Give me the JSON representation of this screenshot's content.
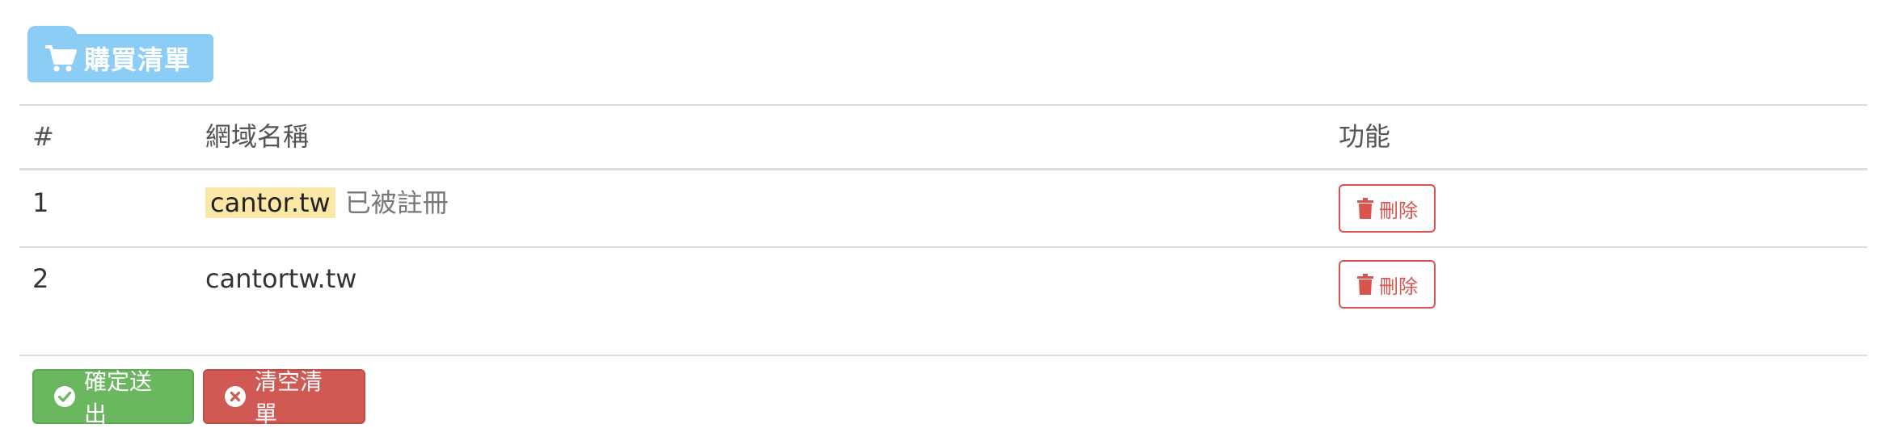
{
  "header": {
    "badge_label": "購買清單",
    "badge_icon": "shopping-cart-icon",
    "badge_color": "#8bcdf5"
  },
  "table": {
    "columns": [
      "#",
      "網域名稱",
      "功能"
    ],
    "rows": [
      {
        "num": "1",
        "domain": "cantor.tw",
        "status_note": "已被註冊",
        "action_label": "刪除"
      },
      {
        "num": "2",
        "domain": "cantortw.tw",
        "status_note": "",
        "action_label": "刪除"
      }
    ]
  },
  "actions": {
    "confirm_label": "確定送出",
    "clear_label": "清空清單",
    "confirm_color": "#6ab75f",
    "clear_color": "#d05954",
    "delete_color": "#d9534f"
  }
}
